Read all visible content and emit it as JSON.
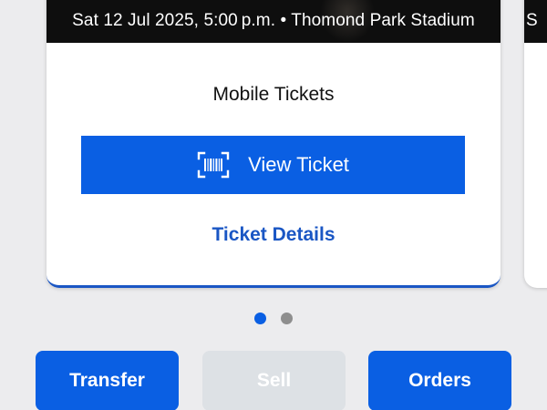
{
  "card": {
    "event_info": "Sat 12 Jul 2025, 5:00 p.m. • Thomond Park Stadium",
    "ticket_type": "Mobile Tickets",
    "view_ticket_label": "View Ticket",
    "ticket_details_label": "Ticket Details",
    "view_ticket_icon": "barcode-scan-icon"
  },
  "next_card": {
    "event_info_peek": "S"
  },
  "pagination": {
    "total": 2,
    "active_index": 0
  },
  "actions": {
    "transfer_label": "Transfer",
    "sell_label": "Sell",
    "orders_label": "Orders",
    "sell_disabled": true
  },
  "colors": {
    "primary": "#0a5fe3",
    "link": "#1a56c4",
    "header_bg": "#0e0e0e",
    "disabled_bg": "#dde1e5",
    "dot_inactive": "#8e8e8e"
  }
}
